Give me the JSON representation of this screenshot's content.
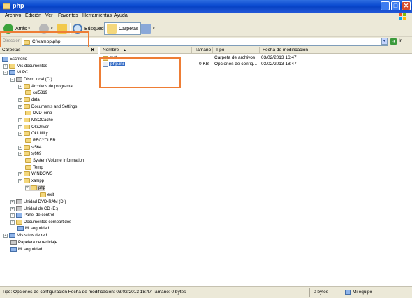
{
  "window": {
    "title": "php"
  },
  "menu": [
    "Archivo",
    "Edición",
    "Ver",
    "Favoritos",
    "Herramientas",
    "Ayuda"
  ],
  "toolbar": {
    "back": "Atrás",
    "search": "Búsqueda",
    "folders": "Carpetas"
  },
  "address": {
    "label": "Dirección",
    "value": "C:\\xampp\\php",
    "go": "Ir"
  },
  "folders": {
    "title": "Carpetas",
    "close": "✕",
    "tree": [
      {
        "label": "Escritorio"
      },
      {
        "label": "Mis documentos"
      },
      {
        "label": "Mi PC"
      },
      {
        "label": "Disco local (C:)"
      },
      {
        "label": "Archivos de programa"
      },
      {
        "label": "col5319"
      },
      {
        "label": "data"
      },
      {
        "label": "Documents and Settings"
      },
      {
        "label": "DVDTemp"
      },
      {
        "label": "MSOCache"
      },
      {
        "label": "OkiDriver"
      },
      {
        "label": "OkiUtility"
      },
      {
        "label": "RECYCLER"
      },
      {
        "label": "sj564"
      },
      {
        "label": "sj669"
      },
      {
        "label": "System Volume Information"
      },
      {
        "label": "Temp"
      },
      {
        "label": "WINDOWS"
      },
      {
        "label": "xampp"
      },
      {
        "label": "php"
      },
      {
        "label": "exit"
      },
      {
        "label": "Unidad DVD-RAM (D:)"
      },
      {
        "label": "Unidad de CD (E:)"
      },
      {
        "label": "Panel de control"
      },
      {
        "label": "Documentos compartidos"
      },
      {
        "label": "Mi seguridad"
      },
      {
        "label": "Mis sitios de red"
      },
      {
        "label": "Papelera de reciclaje"
      },
      {
        "label": "Mi seguridad"
      }
    ]
  },
  "columns": {
    "name": "Nombre",
    "size": "Tamaño",
    "type": "Tipo",
    "modified": "Fecha de modificación"
  },
  "files": [
    {
      "name": "exit",
      "size": "",
      "type": "Carpeta de archivos",
      "modified": "03/02/2013 16:47"
    },
    {
      "name": "php.ini",
      "size": "0 KB",
      "type": "Opciones de config...",
      "modified": "03/02/2013 18:47"
    }
  ],
  "status": {
    "text": "Tipo: Opciones de configuración Fecha de modificación: 03/02/2013 18:47 Tamaño: 0 bytes",
    "bytes": "0 bytes",
    "zone": "Mi equipo"
  }
}
